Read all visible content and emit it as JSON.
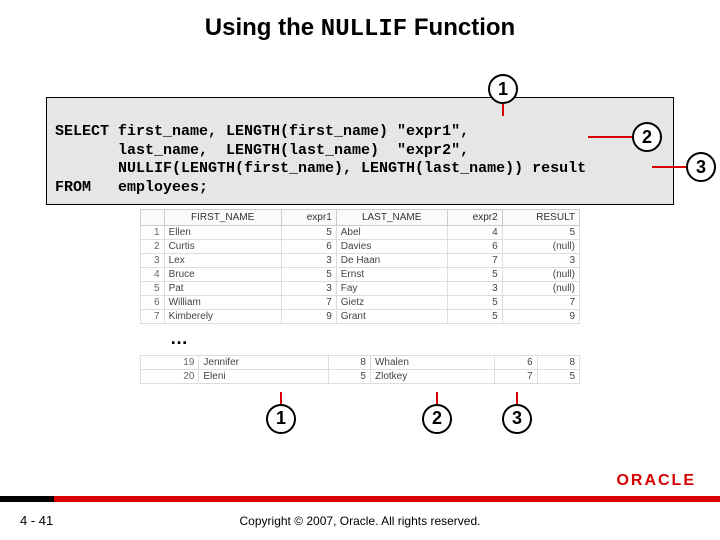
{
  "title_prefix": "Using the ",
  "title_mono": "NULLIF",
  "title_suffix": " Function",
  "sql": {
    "l1": "SELECT first_name, LENGTH(first_name) \"expr1\",",
    "l2": "       last_name,  LENGTH(last_name)  \"expr2\",",
    "l3": "       NULLIF(LENGTH(first_name), LENGTH(last_name)) result",
    "l4": "FROM   employees;"
  },
  "callouts": {
    "one": "1",
    "two": "2",
    "three": "3"
  },
  "columns": {
    "rownum": "",
    "first": "FIRST_NAME",
    "e1": "expr1",
    "last": "LAST_NAME",
    "e2": "expr2",
    "res": "RESULT"
  },
  "rows": [
    {
      "n": "1",
      "first": "Ellen",
      "e1": "5",
      "last": "Abel",
      "e2": "4",
      "res": "5"
    },
    {
      "n": "2",
      "first": "Curtis",
      "e1": "6",
      "last": "Davies",
      "e2": "6",
      "res": "(null)"
    },
    {
      "n": "3",
      "first": "Lex",
      "e1": "3",
      "last": "De Haan",
      "e2": "7",
      "res": "3"
    },
    {
      "n": "4",
      "first": "Bruce",
      "e1": "5",
      "last": "Ernst",
      "e2": "5",
      "res": "(null)"
    },
    {
      "n": "5",
      "first": "Pat",
      "e1": "3",
      "last": "Fay",
      "e2": "3",
      "res": "(null)"
    },
    {
      "n": "6",
      "first": "William",
      "e1": "7",
      "last": "Gietz",
      "e2": "5",
      "res": "7"
    },
    {
      "n": "7",
      "first": "Kimberely",
      "e1": "9",
      "last": "Grant",
      "e2": "5",
      "res": "9"
    }
  ],
  "ellipsis": "…",
  "bottom_rows": [
    {
      "n": "19",
      "first": "Jennifer",
      "e1": "8",
      "last": "Whalen",
      "e2": "6",
      "res": "8"
    },
    {
      "n": "20",
      "first": "Eleni",
      "e1": "5",
      "last": "Zlotkey",
      "e2": "7",
      "res": "5"
    }
  ],
  "bottom_callouts": {
    "one": "1",
    "two": "2",
    "three": "3"
  },
  "footer": {
    "page": "4 - 41",
    "copy": "Copyright © 2007, Oracle. All rights reserved.",
    "logo": "ORACLE"
  },
  "chart_data": {
    "type": "table",
    "title": "NULLIF(LENGTH(first_name), LENGTH(last_name)) result",
    "columns": [
      "FIRST_NAME",
      "expr1",
      "LAST_NAME",
      "expr2",
      "RESULT"
    ],
    "rows": [
      [
        "Ellen",
        5,
        "Abel",
        4,
        5
      ],
      [
        "Curtis",
        6,
        "Davies",
        6,
        null
      ],
      [
        "Lex",
        3,
        "De Haan",
        7,
        3
      ],
      [
        "Bruce",
        5,
        "Ernst",
        5,
        null
      ],
      [
        "Pat",
        3,
        "Fay",
        3,
        null
      ],
      [
        "William",
        7,
        "Gietz",
        5,
        7
      ],
      [
        "Kimberely",
        9,
        "Grant",
        5,
        9
      ],
      [
        "Jennifer",
        8,
        "Whalen",
        6,
        8
      ],
      [
        "Eleni",
        5,
        "Zlotkey",
        7,
        5
      ]
    ]
  }
}
